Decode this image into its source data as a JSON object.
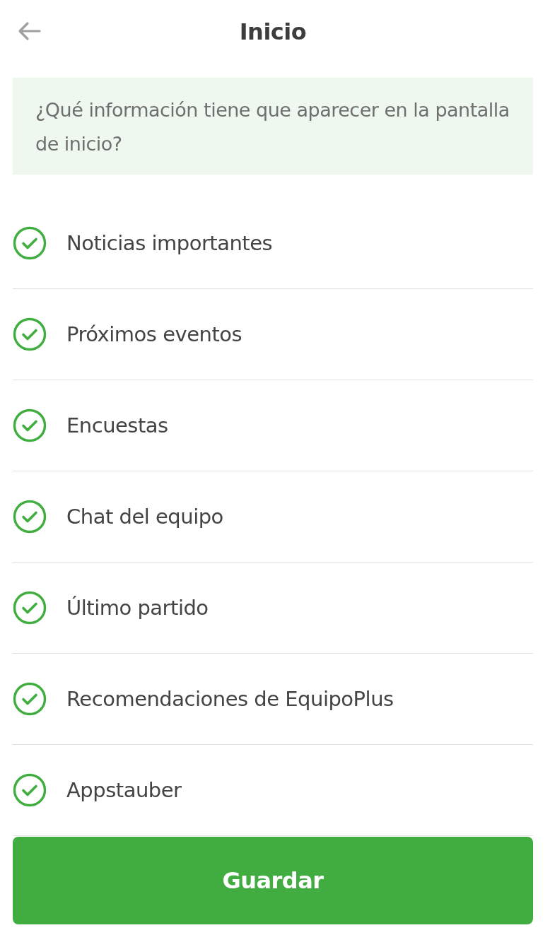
{
  "header": {
    "title": "Inicio"
  },
  "info": {
    "text": "¿Qué información tiene que aparecer en la pantalla de inicio?"
  },
  "options": [
    {
      "label": "Noticias importantes",
      "checked": true
    },
    {
      "label": "Próximos eventos",
      "checked": true
    },
    {
      "label": "Encuestas",
      "checked": true
    },
    {
      "label": "Chat del equipo",
      "checked": true
    },
    {
      "label": "Último partido",
      "checked": true
    },
    {
      "label": "Recomendaciones de EquipoPlus",
      "checked": true
    },
    {
      "label": "Appstauber",
      "checked": true
    }
  ],
  "save_button": {
    "label": "Guardar"
  }
}
